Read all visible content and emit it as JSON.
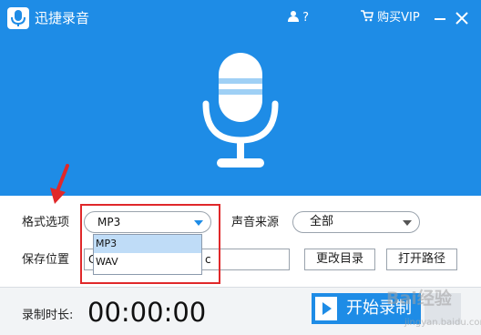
{
  "window": {
    "title": "迅捷录音",
    "help_label": "?",
    "vip_label": "购买VIP"
  },
  "colors": {
    "brand_blue": "#1e8ce6",
    "highlight_red": "#e0282a",
    "selected_item": "#bfdcf7"
  },
  "icons": {
    "app": "microphone-icon",
    "help": "user-icon",
    "vip": "cart-icon",
    "hero": "microphone-icon",
    "start": "play-icon"
  },
  "format": {
    "label": "格式选项",
    "selected": "MP3",
    "options": [
      "MP3",
      "WAV"
    ]
  },
  "source": {
    "label": "声音来源",
    "selected": "全部"
  },
  "save": {
    "label": "保存位置",
    "path_visible_start": "C",
    "path_visible_end": "c"
  },
  "buttons": {
    "change_dir": "更改目录",
    "open_path": "打开路径",
    "start_record": "开始录制"
  },
  "timer": {
    "label": "录制时长:",
    "value": "00:00:00"
  },
  "watermark": {
    "main": "Bai经验",
    "sub": "jingyan.baidu.com"
  }
}
